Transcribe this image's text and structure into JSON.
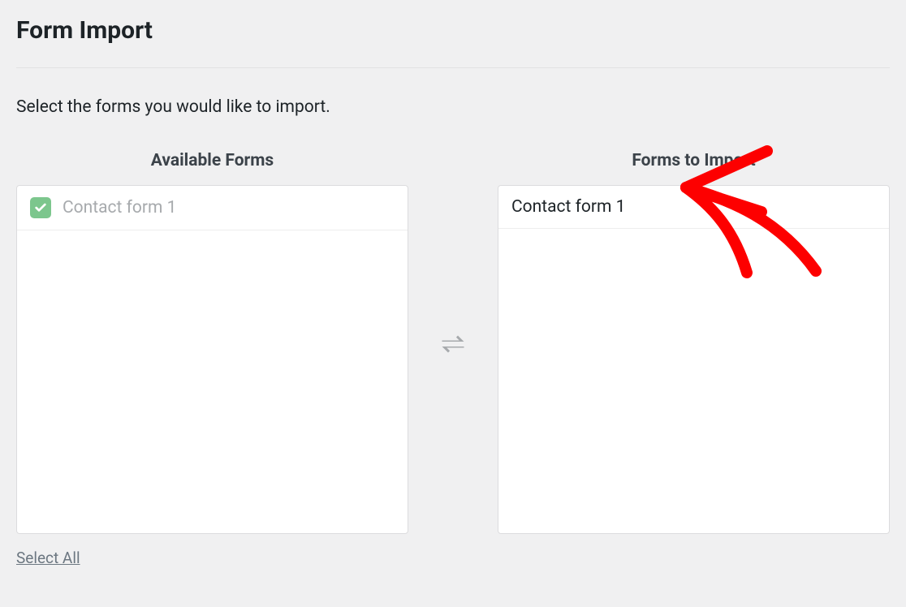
{
  "page": {
    "title": "Form Import",
    "instruction": "Select the forms you would like to import."
  },
  "available": {
    "header": "Available Forms",
    "items": [
      {
        "label": "Contact form 1",
        "checked": true
      }
    ],
    "select_all": "Select All"
  },
  "toimport": {
    "header": "Forms to Import",
    "items": [
      {
        "label": "Contact form 1"
      }
    ]
  }
}
